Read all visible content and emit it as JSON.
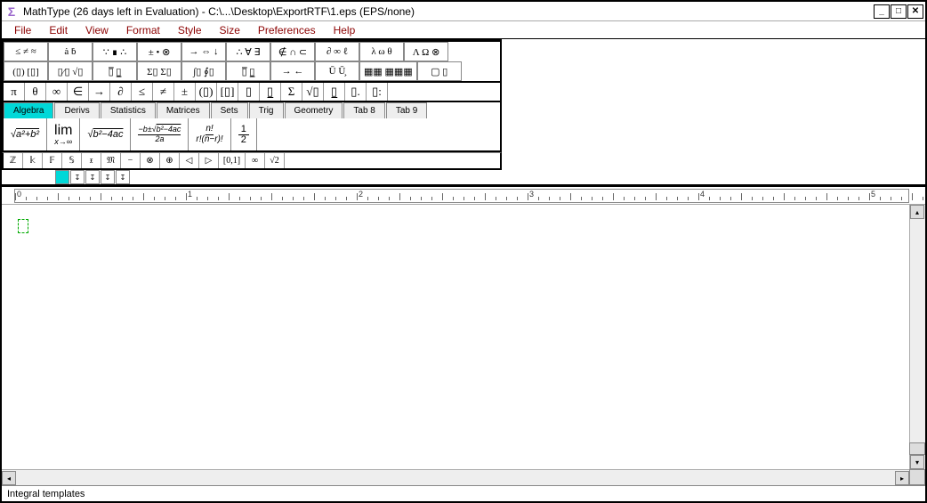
{
  "window": {
    "title": "MathType (26 days left in Evaluation) - C:\\...\\Desktop\\ExportRTF\\1.eps (EPS/none)",
    "icon": "Σ"
  },
  "menu": [
    "File",
    "Edit",
    "View",
    "Format",
    "Style",
    "Size",
    "Preferences",
    "Help"
  ],
  "palette_row1": [
    "≤ ≠ ≈",
    "ȧ ḃ",
    "∵ ∎ ∴",
    "± • ⊗",
    "→ ⇔ ↓",
    "∴ ∀ ∃",
    "∉ ∩ ⊂",
    "∂ ∞ ℓ",
    "λ ω θ",
    "Λ Ω ⊗"
  ],
  "palette_row2": [
    "(▯) [▯]",
    "▯⁄▯ √▯",
    "▯̅ ▯̲",
    "Σ▯ Σ▯",
    "∫▯ ∮▯",
    "▯̅ ▯̲",
    "→  ←",
    "Ū  Ū̧",
    "▦▦ ▦▦▦",
    "▢ ▯"
  ],
  "symbol_bar": [
    "π",
    "θ",
    "∞",
    "∈",
    "→",
    "∂",
    "≤",
    "≠",
    "±",
    "(▯)",
    "[▯]",
    "▯",
    "▯̲",
    "Σ",
    "√▯",
    "▯̲",
    "▯.",
    "▯:"
  ],
  "tabs": [
    "Algebra",
    "Derivs",
    "Statistics",
    "Matrices",
    "Sets",
    "Trig",
    "Geometry",
    "Tab 8",
    "Tab 9"
  ],
  "templates": {
    "sqrt_sum": "√(a²+b²)",
    "limit": "lim x→∞",
    "sqrt_quad": "√(b²−4ac)",
    "quad_frac": "(−b±√(b²−4ac))/2a",
    "comb": "n! / r!(n−r)!",
    "half": "½"
  },
  "small_row": [
    "ℤ",
    "𝕜",
    "𝔽",
    "𝕊",
    "𝔵",
    "𝔐",
    "−",
    "⊗",
    "⊕",
    "◁",
    "▷",
    "[0,1]",
    "∞",
    "√2"
  ],
  "ruler_marks": [
    "0",
    "1",
    "2",
    "3",
    "4",
    "5"
  ],
  "status": "Integral templates"
}
